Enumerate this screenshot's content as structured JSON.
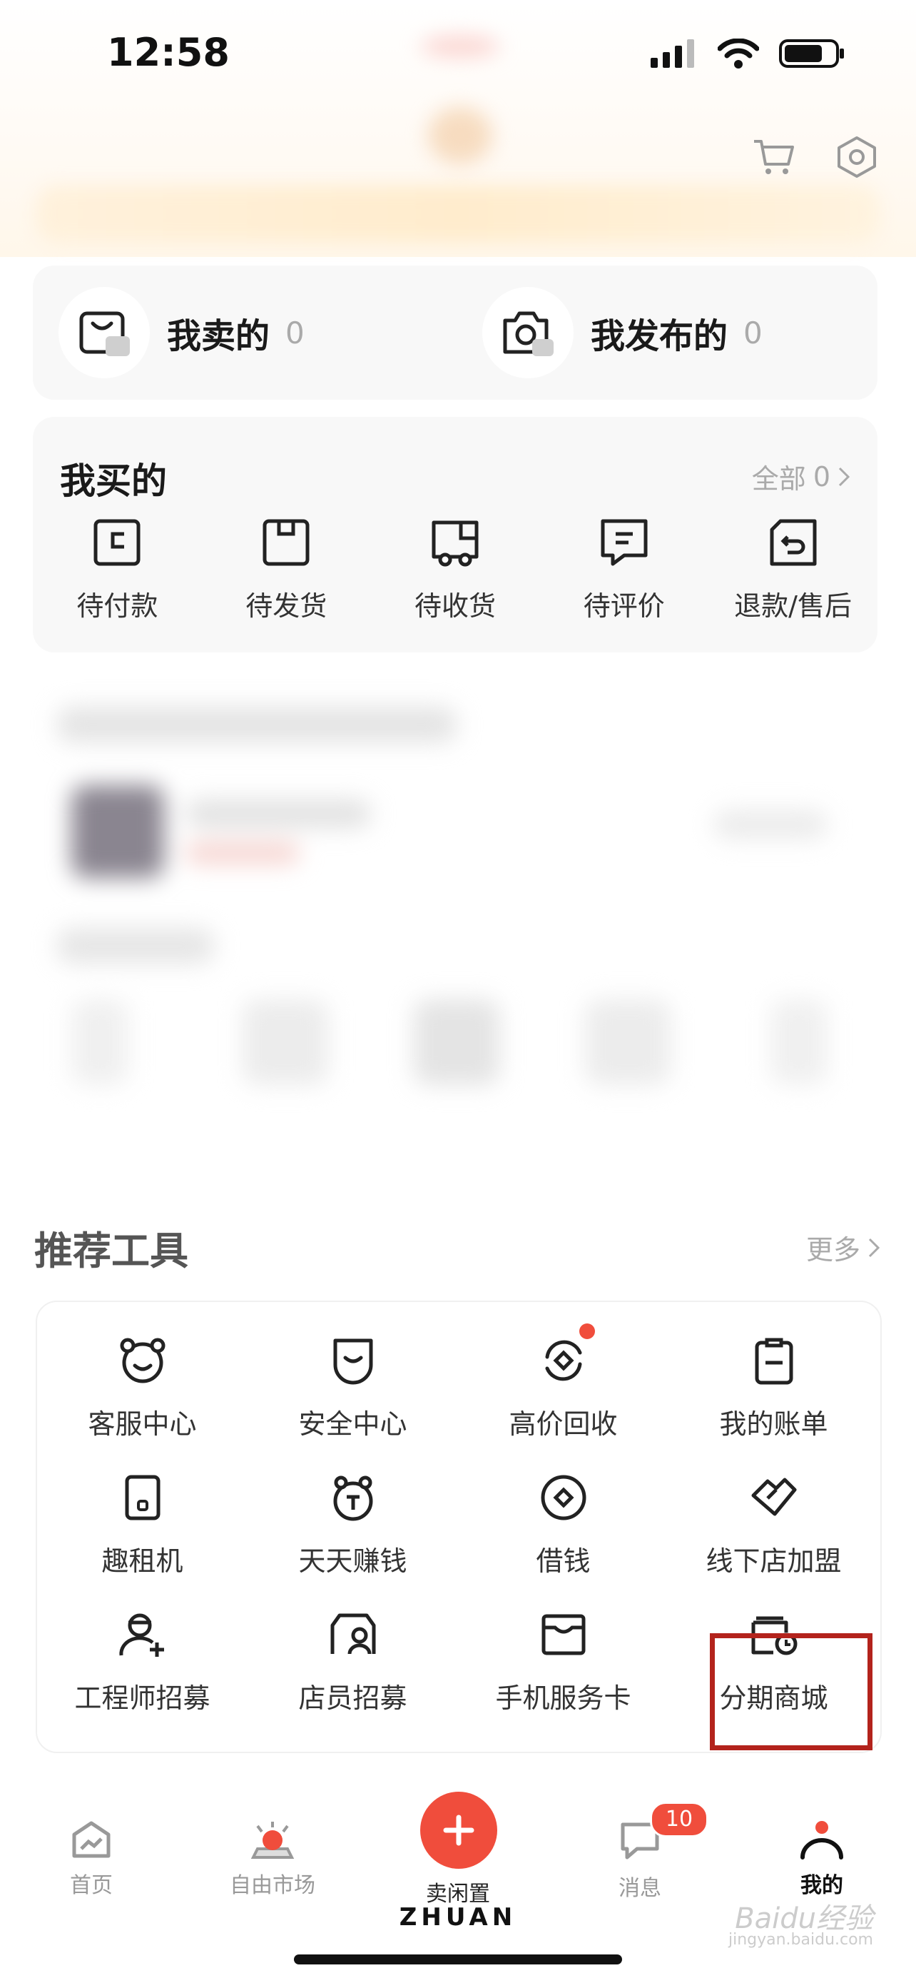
{
  "status_bar": {
    "time": "12:58"
  },
  "sell_section": {
    "sold": {
      "label": "我卖的",
      "count": "0"
    },
    "published": {
      "label": "我发布的",
      "count": "0"
    }
  },
  "buy_section": {
    "title": "我买的",
    "all_label": "全部",
    "all_count": "0",
    "items": [
      {
        "label": "待付款",
        "icon": "card-icon"
      },
      {
        "label": "待发货",
        "icon": "box-icon"
      },
      {
        "label": "待收货",
        "icon": "truck-icon"
      },
      {
        "label": "待评价",
        "icon": "comment-icon"
      },
      {
        "label": "退款/售后",
        "icon": "return-icon"
      }
    ]
  },
  "tools": {
    "title": "推荐工具",
    "more_label": "更多",
    "items": [
      {
        "label": "客服中心",
        "icon": "bear-icon"
      },
      {
        "label": "安全中心",
        "icon": "shield-icon"
      },
      {
        "label": "高价回收",
        "icon": "recycle-icon",
        "dot": true
      },
      {
        "label": "我的账单",
        "icon": "bill-icon"
      },
      {
        "label": "趣租机",
        "icon": "phone-icon"
      },
      {
        "label": "天天赚钱",
        "icon": "coin-bear-icon"
      },
      {
        "label": "借钱",
        "icon": "coin-icon"
      },
      {
        "label": "线下店加盟",
        "icon": "handshake-icon"
      },
      {
        "label": "工程师招募",
        "icon": "engineer-icon"
      },
      {
        "label": "店员招募",
        "icon": "clerk-icon"
      },
      {
        "label": "手机服务卡",
        "icon": "service-card-icon"
      },
      {
        "label": "分期商城",
        "icon": "installment-icon"
      }
    ]
  },
  "tabbar": {
    "home": "首页",
    "market": "自由市场",
    "sell": "卖闲置",
    "messages": "消息",
    "messages_badge": "10",
    "mine": "我的",
    "brand": "ZHUAN"
  },
  "watermark": {
    "text": "Baidu经验",
    "sub": "jingyan.baidu.com"
  },
  "colors": {
    "accent": "#f04d3c",
    "highlight": "#b3231c"
  }
}
